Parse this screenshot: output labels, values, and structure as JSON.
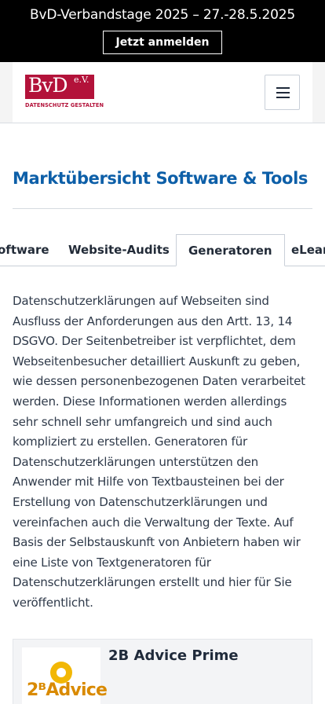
{
  "announcement": {
    "text": "BvD-Verbandstage 2025 –  27.-28.5.2025",
    "button_label": "Jetzt anmelden"
  },
  "header": {
    "logo_text": "BvD",
    "logo_superscript": "e.V.",
    "logo_tagline": "DATENSCHUTZ GESTALTEN",
    "menu_icon": "hamburger-menu-icon"
  },
  "page": {
    "title": "Marktübersicht Software & Tools"
  },
  "tabs": [
    {
      "label": "oftware",
      "active": false
    },
    {
      "label": "Website-Audits",
      "active": false
    },
    {
      "label": "Generatoren",
      "active": true
    },
    {
      "label": "eLearn",
      "active": false
    }
  ],
  "intro": "Datenschutzerklärungen auf Webseiten sind Ausfluss der Anforderungen aus den Artt. 13, 14 DSGVO. Der Seitenbetreiber ist verpflichtet, dem Webseitenbesucher detailliert Auskunft zu geben, wie dessen personenbezogenen Daten verarbeitet werden. Diese Informationen werden allerdings sehr schnell sehr umfangreich und sind auch kompliziert zu erstellen. Generatoren für Datenschutzerklärungen unterstützen den Anwender mit Hilfe von Textbausteinen bei der Erstellung von Datenschutzerklärungen und vereinfachen auch die Verwaltung der Texte. Auf Basis der Selbstauskunft von Anbietern haben wir eine Liste von Textgeneratoren für Datenschutzerklärungen erstellt und hier für Sie veröffentlicht.",
  "cards": [
    {
      "title": "2B Advice Prime",
      "logo_text": "2ᴮAdvice"
    }
  ],
  "colors": {
    "brand_red": "#b3123a",
    "title_blue": "#0d5fa8",
    "announcement_bg": "#000000"
  }
}
